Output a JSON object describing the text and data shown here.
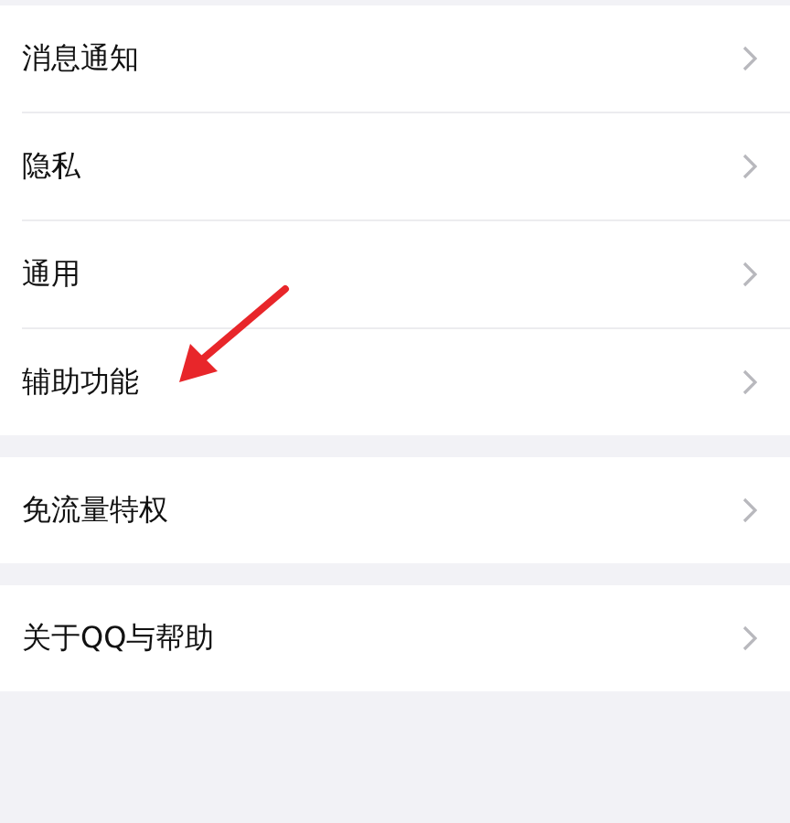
{
  "groups": [
    {
      "items": [
        {
          "label": "消息通知"
        },
        {
          "label": "隐私"
        },
        {
          "label": "通用"
        },
        {
          "label": "辅助功能"
        }
      ]
    },
    {
      "items": [
        {
          "label": "免流量特权"
        }
      ]
    },
    {
      "items": [
        {
          "label": "关于QQ与帮助"
        }
      ]
    }
  ]
}
